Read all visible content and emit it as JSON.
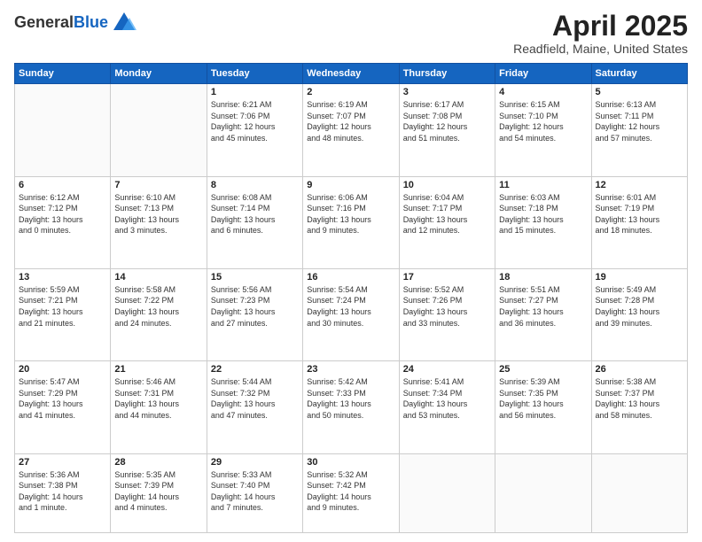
{
  "header": {
    "logo_general": "General",
    "logo_blue": "Blue",
    "month_title": "April 2025",
    "location": "Readfield, Maine, United States"
  },
  "days_of_week": [
    "Sunday",
    "Monday",
    "Tuesday",
    "Wednesday",
    "Thursday",
    "Friday",
    "Saturday"
  ],
  "weeks": [
    [
      {
        "day": "",
        "content": ""
      },
      {
        "day": "",
        "content": ""
      },
      {
        "day": "1",
        "content": "Sunrise: 6:21 AM\nSunset: 7:06 PM\nDaylight: 12 hours\nand 45 minutes."
      },
      {
        "day": "2",
        "content": "Sunrise: 6:19 AM\nSunset: 7:07 PM\nDaylight: 12 hours\nand 48 minutes."
      },
      {
        "day": "3",
        "content": "Sunrise: 6:17 AM\nSunset: 7:08 PM\nDaylight: 12 hours\nand 51 minutes."
      },
      {
        "day": "4",
        "content": "Sunrise: 6:15 AM\nSunset: 7:10 PM\nDaylight: 12 hours\nand 54 minutes."
      },
      {
        "day": "5",
        "content": "Sunrise: 6:13 AM\nSunset: 7:11 PM\nDaylight: 12 hours\nand 57 minutes."
      }
    ],
    [
      {
        "day": "6",
        "content": "Sunrise: 6:12 AM\nSunset: 7:12 PM\nDaylight: 13 hours\nand 0 minutes."
      },
      {
        "day": "7",
        "content": "Sunrise: 6:10 AM\nSunset: 7:13 PM\nDaylight: 13 hours\nand 3 minutes."
      },
      {
        "day": "8",
        "content": "Sunrise: 6:08 AM\nSunset: 7:14 PM\nDaylight: 13 hours\nand 6 minutes."
      },
      {
        "day": "9",
        "content": "Sunrise: 6:06 AM\nSunset: 7:16 PM\nDaylight: 13 hours\nand 9 minutes."
      },
      {
        "day": "10",
        "content": "Sunrise: 6:04 AM\nSunset: 7:17 PM\nDaylight: 13 hours\nand 12 minutes."
      },
      {
        "day": "11",
        "content": "Sunrise: 6:03 AM\nSunset: 7:18 PM\nDaylight: 13 hours\nand 15 minutes."
      },
      {
        "day": "12",
        "content": "Sunrise: 6:01 AM\nSunset: 7:19 PM\nDaylight: 13 hours\nand 18 minutes."
      }
    ],
    [
      {
        "day": "13",
        "content": "Sunrise: 5:59 AM\nSunset: 7:21 PM\nDaylight: 13 hours\nand 21 minutes."
      },
      {
        "day": "14",
        "content": "Sunrise: 5:58 AM\nSunset: 7:22 PM\nDaylight: 13 hours\nand 24 minutes."
      },
      {
        "day": "15",
        "content": "Sunrise: 5:56 AM\nSunset: 7:23 PM\nDaylight: 13 hours\nand 27 minutes."
      },
      {
        "day": "16",
        "content": "Sunrise: 5:54 AM\nSunset: 7:24 PM\nDaylight: 13 hours\nand 30 minutes."
      },
      {
        "day": "17",
        "content": "Sunrise: 5:52 AM\nSunset: 7:26 PM\nDaylight: 13 hours\nand 33 minutes."
      },
      {
        "day": "18",
        "content": "Sunrise: 5:51 AM\nSunset: 7:27 PM\nDaylight: 13 hours\nand 36 minutes."
      },
      {
        "day": "19",
        "content": "Sunrise: 5:49 AM\nSunset: 7:28 PM\nDaylight: 13 hours\nand 39 minutes."
      }
    ],
    [
      {
        "day": "20",
        "content": "Sunrise: 5:47 AM\nSunset: 7:29 PM\nDaylight: 13 hours\nand 41 minutes."
      },
      {
        "day": "21",
        "content": "Sunrise: 5:46 AM\nSunset: 7:31 PM\nDaylight: 13 hours\nand 44 minutes."
      },
      {
        "day": "22",
        "content": "Sunrise: 5:44 AM\nSunset: 7:32 PM\nDaylight: 13 hours\nand 47 minutes."
      },
      {
        "day": "23",
        "content": "Sunrise: 5:42 AM\nSunset: 7:33 PM\nDaylight: 13 hours\nand 50 minutes."
      },
      {
        "day": "24",
        "content": "Sunrise: 5:41 AM\nSunset: 7:34 PM\nDaylight: 13 hours\nand 53 minutes."
      },
      {
        "day": "25",
        "content": "Sunrise: 5:39 AM\nSunset: 7:35 PM\nDaylight: 13 hours\nand 56 minutes."
      },
      {
        "day": "26",
        "content": "Sunrise: 5:38 AM\nSunset: 7:37 PM\nDaylight: 13 hours\nand 58 minutes."
      }
    ],
    [
      {
        "day": "27",
        "content": "Sunrise: 5:36 AM\nSunset: 7:38 PM\nDaylight: 14 hours\nand 1 minute."
      },
      {
        "day": "28",
        "content": "Sunrise: 5:35 AM\nSunset: 7:39 PM\nDaylight: 14 hours\nand 4 minutes."
      },
      {
        "day": "29",
        "content": "Sunrise: 5:33 AM\nSunset: 7:40 PM\nDaylight: 14 hours\nand 7 minutes."
      },
      {
        "day": "30",
        "content": "Sunrise: 5:32 AM\nSunset: 7:42 PM\nDaylight: 14 hours\nand 9 minutes."
      },
      {
        "day": "",
        "content": ""
      },
      {
        "day": "",
        "content": ""
      },
      {
        "day": "",
        "content": ""
      }
    ]
  ]
}
